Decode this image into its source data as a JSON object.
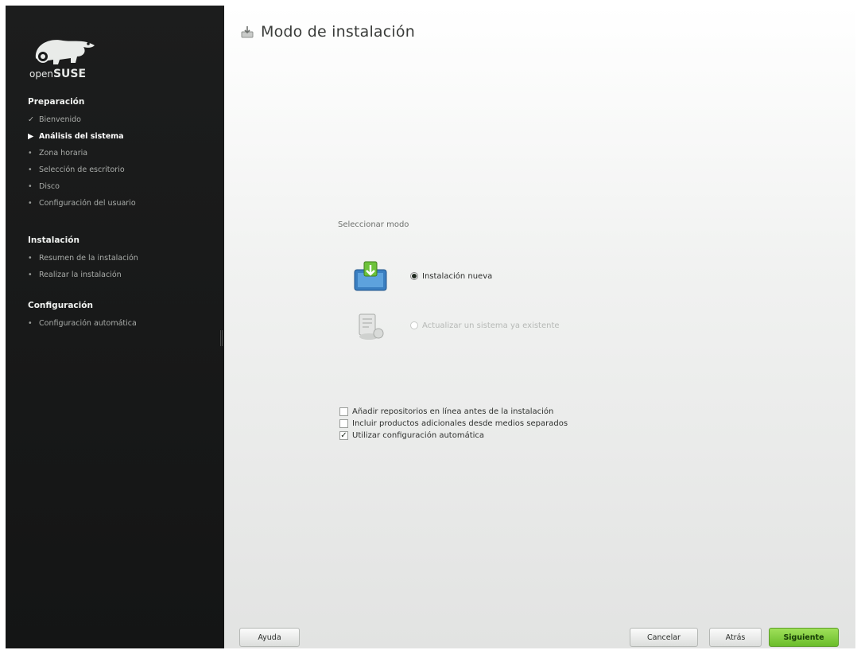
{
  "brand": {
    "prefix": "open",
    "name": "SUSE"
  },
  "sidebar": {
    "sections": [
      {
        "title": "Preparación",
        "steps": [
          {
            "label": "Bienvenido",
            "state": "done"
          },
          {
            "label": "Análisis del sistema",
            "state": "current"
          },
          {
            "label": "Zona horaria",
            "state": "pending"
          },
          {
            "label": "Selección de escritorio",
            "state": "pending"
          },
          {
            "label": "Disco",
            "state": "pending"
          },
          {
            "label": "Configuración del usuario",
            "state": "pending"
          }
        ]
      },
      {
        "title": "Instalación",
        "steps": [
          {
            "label": "Resumen de la instalación",
            "state": "pending"
          },
          {
            "label": "Realizar la instalación",
            "state": "pending"
          }
        ]
      },
      {
        "title": "Configuración",
        "steps": [
          {
            "label": "Configuración automática",
            "state": "pending"
          }
        ]
      }
    ]
  },
  "main": {
    "title": "Modo de instalación",
    "select_label": "Seleccionar modo",
    "options": {
      "new": {
        "label": "Instalación nueva",
        "selected": true,
        "icon": "new-install-icon"
      },
      "update": {
        "label": "Actualizar un sistema ya existente",
        "selected": false,
        "disabled": true,
        "icon": "update-system-icon"
      }
    },
    "checkboxes": {
      "online_repos": {
        "label": "Añadir repositorios en línea antes de la instalación",
        "checked": false
      },
      "addon_products": {
        "label": "Incluir productos adicionales desde medios separados",
        "checked": false
      },
      "auto_config": {
        "label": "Utilizar configuración automática",
        "checked": true
      }
    }
  },
  "footer": {
    "help": "Ayuda",
    "abort": "Cancelar",
    "back": "Atrás",
    "next": "Siguiente"
  },
  "colors": {
    "sidebar_bg": "#181919",
    "accent_green": "#73c232",
    "main_bg": "#eeefee"
  }
}
